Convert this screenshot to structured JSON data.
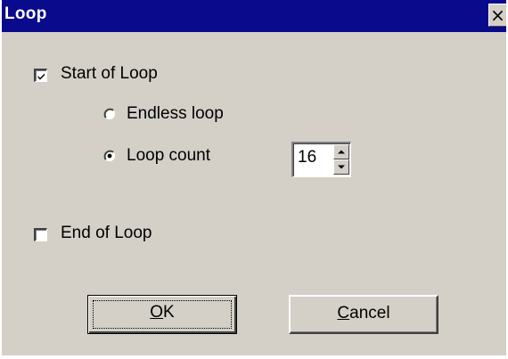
{
  "window": {
    "title": "Loop",
    "close_glyph": "×"
  },
  "options": {
    "start_of_loop": {
      "label": "Start of Loop",
      "checked": true
    },
    "endless_loop": {
      "label": "Endless loop",
      "selected": false
    },
    "loop_count": {
      "label": "Loop count",
      "selected": true,
      "value": "16"
    },
    "end_of_loop": {
      "label": "End of Loop",
      "checked": false
    }
  },
  "buttons": {
    "ok_mnemonic": "O",
    "ok_rest": "K",
    "cancel_mnemonic": "C",
    "cancel_rest": "ancel"
  },
  "colors": {
    "titlebar": "#0a0a8c",
    "face": "#d4d0c8"
  }
}
